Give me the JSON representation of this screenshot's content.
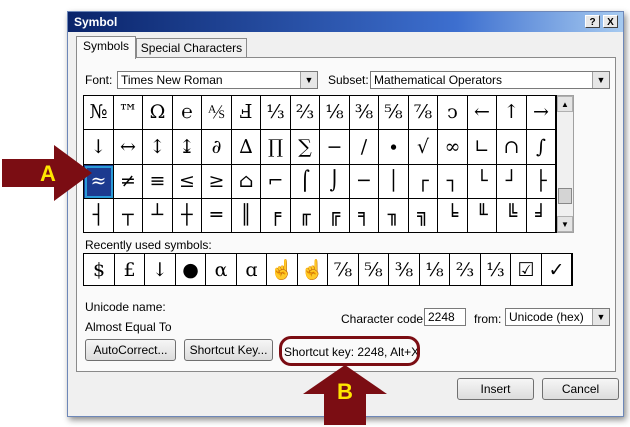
{
  "window": {
    "title": "Symbol",
    "help_label": "?",
    "close_label": "X"
  },
  "tabs": [
    {
      "label": "Symbols",
      "active": true
    },
    {
      "label": "Special Characters",
      "active": false
    }
  ],
  "font": {
    "label": "Font:",
    "value": "Times New Roman"
  },
  "subset": {
    "label": "Subset:",
    "value": "Mathematical Operators"
  },
  "symbol_grid": {
    "rows": [
      [
        "№",
        "™",
        "Ω",
        "℮",
        "⅍",
        "Ⅎ",
        "⅓",
        "⅔",
        "⅛",
        "⅜",
        "⅝",
        "⅞",
        "ↄ",
        "←",
        "↑",
        "→"
      ],
      [
        "↓",
        "↔",
        "↕",
        "↨",
        "∂",
        "∆",
        "∏",
        "∑",
        "−",
        "∕",
        "∙",
        "√",
        "∞",
        "∟",
        "∩",
        "∫"
      ],
      [
        "≈",
        "≠",
        "≡",
        "≤",
        "≥",
        "⌂",
        "⌐",
        "⌠",
        "⌡",
        "─",
        "│",
        "┌",
        "┐",
        "└",
        "┘",
        "├"
      ],
      [
        "┤",
        "┬",
        "┴",
        "┼",
        "═",
        "║",
        "╒",
        "╓",
        "╔",
        "╕",
        "╖",
        "╗",
        "╘",
        "╙",
        "╚",
        "╛"
      ]
    ],
    "selected": "≈"
  },
  "recently_used": {
    "label": "Recently used symbols:",
    "symbols": [
      "$",
      "£",
      "↓",
      "●",
      "α",
      "ɑ",
      "☝",
      "☝",
      "⅞",
      "⅝",
      "⅜",
      "⅛",
      "⅔",
      "⅓",
      "☑",
      "✓"
    ]
  },
  "unicode_name": {
    "label": "Unicode name:",
    "value": "Almost Equal To"
  },
  "character_code": {
    "label": "Character code:",
    "value": "2248"
  },
  "from": {
    "label": "from:",
    "value": "Unicode (hex)"
  },
  "buttons": {
    "autocorrect": "AutoCorrect...",
    "shortcut_key": "Shortcut Key...",
    "insert": "Insert",
    "cancel": "Cancel"
  },
  "shortcut_text": "Shortcut key: 2248, Alt+X",
  "callouts": {
    "a": "A",
    "b": "B"
  },
  "colors": {
    "callout": "#7b0d13",
    "callout_text": "#ffe600",
    "selected_cell": "#1c3a8f",
    "titlebar": "#0a246a"
  }
}
